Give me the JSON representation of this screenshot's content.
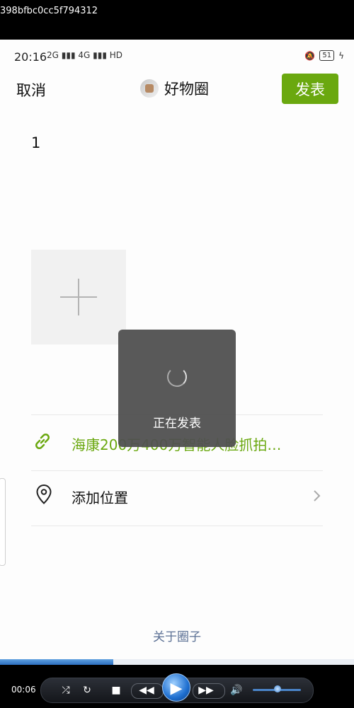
{
  "topbar": {
    "hash": "398bfbc0cc5f794312"
  },
  "status": {
    "time": "20:16",
    "network": "2G ▮▮▮ 4G ▮▮▮ HD",
    "battery": "51"
  },
  "header": {
    "cancel": "取消",
    "title": "好物圈",
    "publish": "发表"
  },
  "post": {
    "text": "1"
  },
  "link": {
    "text": "海康200万400万智能人脸抓拍…"
  },
  "location": {
    "label": "添加位置"
  },
  "toast": {
    "text": "正在发表"
  },
  "footer": {
    "about": "关于圈子"
  },
  "player": {
    "time": "00:06",
    "progress_fraction": 0.32,
    "volume_fraction": 0.45
  },
  "colors": {
    "accent": "#6aa80f",
    "about_link": "#5b7094"
  }
}
